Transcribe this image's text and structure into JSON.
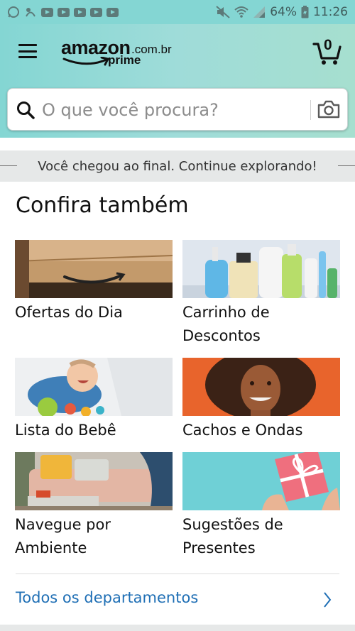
{
  "status_bar": {
    "battery": "64%",
    "time": "11:26",
    "icons_left": [
      "whatsapp-icon",
      "app-icon",
      "youtube-icon",
      "youtube-icon",
      "youtube-icon",
      "youtube-icon",
      "youtube-icon"
    ],
    "icons_right": [
      "mute-icon",
      "wifi-icon",
      "signal-icon",
      "battery-icon"
    ]
  },
  "header": {
    "logo_main": "amazon",
    "logo_domain": ".com.br",
    "logo_prime": "prime",
    "cart_count": "0"
  },
  "search": {
    "placeholder": "O que você procura?"
  },
  "end_banner": {
    "text": "Você chegou ao final. Continue explorando!"
  },
  "section": {
    "title": "Confira também",
    "tiles": [
      {
        "label": "Ofertas do Dia"
      },
      {
        "label": "Carrinho de Descontos"
      },
      {
        "label": "Lista do Bebê"
      },
      {
        "label": "Cachos e Ondas"
      },
      {
        "label": "Navegue por Ambiente"
      },
      {
        "label": "Sugestões de Presentes"
      }
    ]
  },
  "footer": {
    "all_departments": "Todos os departamentos"
  },
  "colors": {
    "header_teal": "#84d6d3",
    "link_blue": "#1f6fb5",
    "banner_gray": "#e6e8e8"
  }
}
